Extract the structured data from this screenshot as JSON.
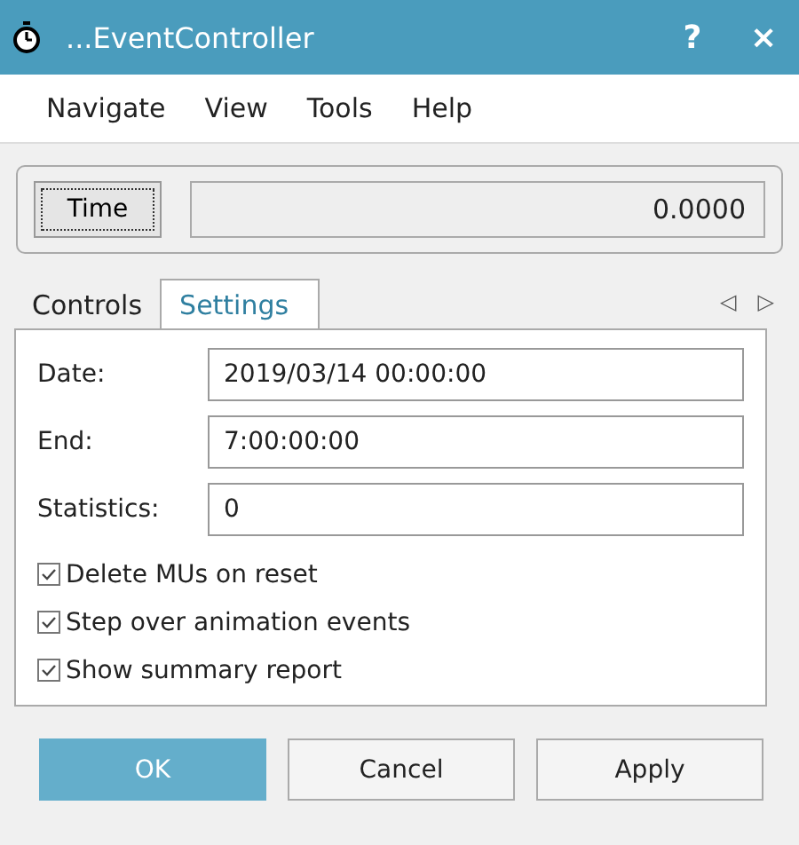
{
  "window": {
    "title": "...EventController",
    "help": "?",
    "close": "×"
  },
  "menu": [
    "Navigate",
    "View",
    "Tools",
    "Help"
  ],
  "time": {
    "button": "Time",
    "value": "0.0000"
  },
  "tabs": [
    {
      "label": "Controls",
      "selected": false
    },
    {
      "label": "Settings",
      "selected": true
    }
  ],
  "tab_arrows": [
    "◁",
    "▷"
  ],
  "fields": [
    {
      "label": "Date:",
      "value": "2019/03/14 00:00:00"
    },
    {
      "label": "End:",
      "value": "7:00:00:00"
    },
    {
      "label": "Statistics:",
      "value": "0"
    }
  ],
  "options": [
    {
      "label": "Delete MUs on reset",
      "checked": true
    },
    {
      "label": "Step over animation events",
      "checked": true
    },
    {
      "label": "Show summary report",
      "checked": true
    }
  ],
  "buttons": [
    {
      "label": "OK",
      "default": true
    },
    {
      "label": "Cancel",
      "default": false
    },
    {
      "label": "Apply",
      "default": false
    }
  ]
}
